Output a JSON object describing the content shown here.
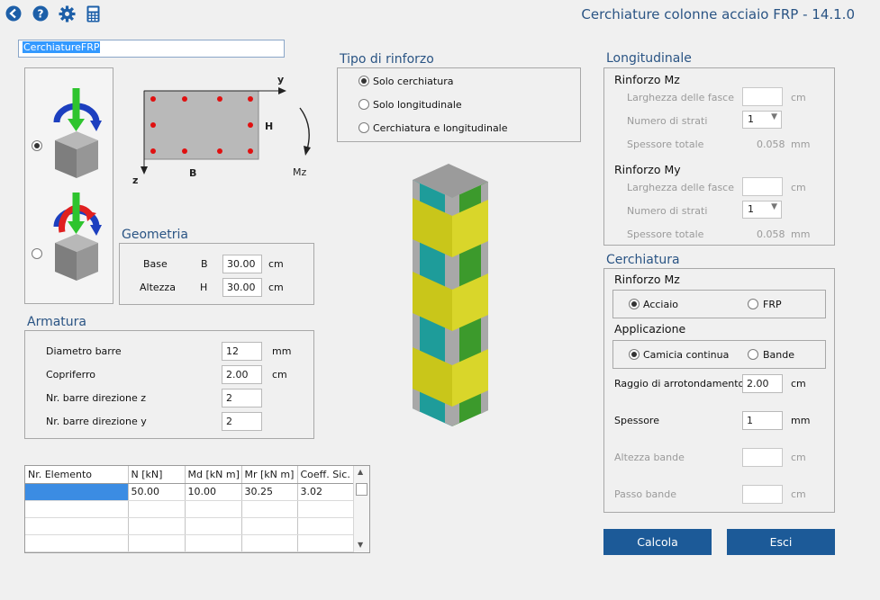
{
  "toolbar": {
    "back_icon": "back-arrow-icon",
    "help_icon": "help-icon",
    "settings_icon": "gear-icon",
    "calculator_icon": "calculator-icon"
  },
  "app_title": "Cerchiature colonne acciaio FRP - 14.1.0",
  "project_name": "CerchiatureFRP",
  "diagram": {
    "axis_y": "y",
    "axis_z": "z",
    "label_h": "H",
    "label_b": "B",
    "moment": "Mz"
  },
  "load_options": {
    "uniaxial_selected": true
  },
  "geometria": {
    "title": "Geometria",
    "rows": [
      {
        "label": "Base",
        "symbol": "B",
        "value": "30.00",
        "unit": "cm"
      },
      {
        "label": "Altezza",
        "symbol": "H",
        "value": "30.00",
        "unit": "cm"
      }
    ]
  },
  "armatura": {
    "title": "Armatura",
    "rows": [
      {
        "label": "Diametro barre",
        "value": "12",
        "unit": "mm"
      },
      {
        "label": "Copriferro",
        "value": "2.00",
        "unit": "cm"
      },
      {
        "label": "Nr. barre direzione z",
        "value": "2",
        "unit": ""
      },
      {
        "label": "Nr. barre direzione y",
        "value": "2",
        "unit": ""
      }
    ]
  },
  "tipo_rinforzo": {
    "title": "Tipo di rinforzo",
    "options": [
      "Solo cerchiatura",
      "Solo longitudinale",
      "Cerchiatura e longitudinale"
    ],
    "selected": 0
  },
  "longitudinale": {
    "title": "Longitudinale",
    "mz": {
      "title": "Rinforzo Mz",
      "width_label": "Larghezza delle fasce",
      "width_value": "",
      "width_unit": "cm",
      "layers_label": "Numero di strati",
      "layers_value": "1",
      "thickness_label": "Spessore totale",
      "thickness_value": "0.058",
      "thickness_unit": "mm"
    },
    "my": {
      "title": "Rinforzo My",
      "width_label": "Larghezza delle fasce",
      "width_value": "",
      "width_unit": "cm",
      "layers_label": "Numero di strati",
      "layers_value": "1",
      "thickness_label": "Spessore totale",
      "thickness_value": "0.058",
      "thickness_unit": "mm"
    }
  },
  "cerchiatura": {
    "title": "Cerchiatura",
    "rinforzo_title": "Rinforzo Mz",
    "material_options": [
      "Acciaio",
      "FRP"
    ],
    "material_selected": 0,
    "application_title": "Applicazione",
    "application_options": [
      "Camicia continua",
      "Bande"
    ],
    "application_selected": 0,
    "radius_label": "Raggio di arrotondamento",
    "radius_value": "2.00",
    "radius_unit": "cm",
    "thickness_label": "Spessore",
    "thickness_value": "1",
    "thickness_unit": "mm",
    "band_height_label": "Altezza bande",
    "band_height_value": "",
    "band_height_unit": "cm",
    "band_pitch_label": "Passo bande",
    "band_pitch_value": "",
    "band_pitch_unit": "cm"
  },
  "results_table": {
    "columns": [
      "Nr. Elemento",
      "N [kN]",
      "Md [kN m]",
      "Mr [kN m]",
      "Coeff. Sic."
    ],
    "rows": [
      [
        "",
        "50.00",
        "10.00",
        "30.25",
        "3.02"
      ],
      [
        "",
        "",
        "",
        "",
        ""
      ],
      [
        "",
        "",
        "",
        "",
        ""
      ],
      [
        "",
        "",
        "",
        "",
        ""
      ]
    ]
  },
  "buttons": {
    "calcola": "Calcola",
    "esci": "Esci"
  },
  "colors": {
    "accent": "#1c5a98",
    "title": "#2a5484",
    "jacket": "#c9c61a",
    "column_teal": "#1e9c9a",
    "column_green": "#3c9a2c"
  }
}
